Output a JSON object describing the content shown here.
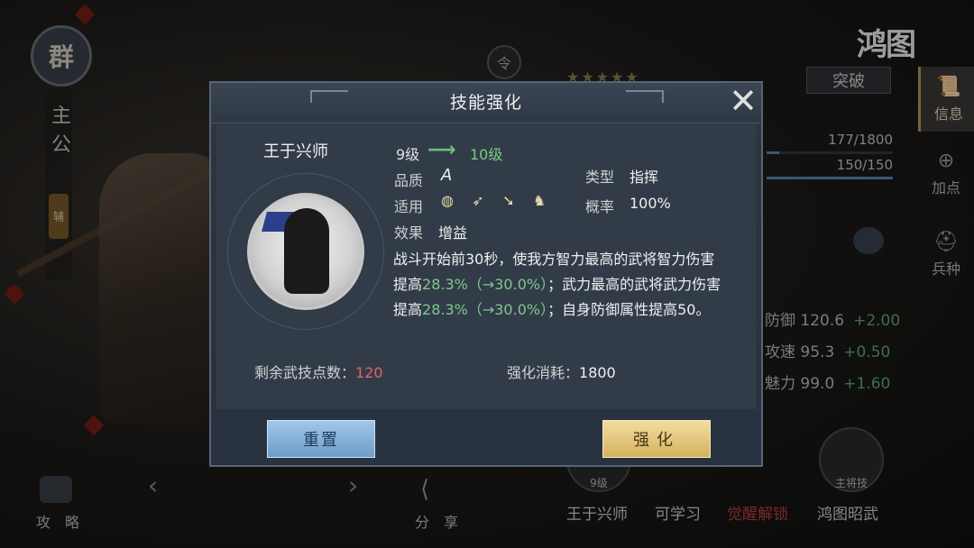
{
  "game": {
    "faction": "群",
    "lord_label": "主公",
    "side_tag": "辅",
    "token": "令",
    "logo": "鸿图",
    "breakthrough_label": "突破",
    "stars": "★★★★★",
    "side_tabs": [
      {
        "label": "信息",
        "icon": "scroll-icon",
        "active": true
      },
      {
        "label": "加点",
        "icon": "add-point-icon",
        "active": false
      },
      {
        "label": "兵种",
        "icon": "helmet-icon",
        "active": false
      }
    ],
    "exp_text": "177/1800",
    "exp_fraction": 0.098,
    "hp_text": "150/150",
    "hp_fraction": 1.0,
    "stats": [
      {
        "name": "防御",
        "value": "120.6",
        "bonus": "+2.00"
      },
      {
        "name": "攻速",
        "value": "95.3",
        "bonus": "+0.50"
      },
      {
        "name": "魅力",
        "value": "99.0",
        "bonus": "+1.60"
      }
    ],
    "bottom_skills": [
      {
        "name": "王于兴师",
        "badge": "9级"
      },
      {
        "name": "可学习",
        "badge": ""
      },
      {
        "name": "觉醒解锁",
        "badge": ""
      },
      {
        "name": "鸿图昭武",
        "badge": "主将技"
      }
    ],
    "guide_label": "攻　略",
    "share_label": "分　享"
  },
  "modal": {
    "title": "技能强化",
    "skill_name": "王于兴师",
    "level_from": "9级",
    "level_to": "10级",
    "quality_label": "品质",
    "quality_value": "A",
    "type_label": "类型",
    "type_value": "指挥",
    "apply_label": "适用",
    "apply_icons": [
      "shield-icon",
      "bow-icon",
      "spear-icon",
      "horse-icon"
    ],
    "rate_label": "概率",
    "rate_value": "100%",
    "effect_label": "效果",
    "effect_value": "增益",
    "desc_1": "战斗开始前30秒，使我方智力最高的武将智力伤害提高",
    "desc_g1": "28.3%（→30.0%）",
    "desc_2": "；武力最高的武将武力伤害提高",
    "desc_g2": "28.3%（→30.0%）",
    "desc_3": "；自身防御属性提高50。",
    "points_label": "剩余武技点数：",
    "points_value": "120",
    "cost_label": "强化消耗：",
    "cost_value": "1800",
    "reset_label": "重置",
    "enhance_label": "强化"
  },
  "colors": {
    "highlight_green": "#7ec98a",
    "points_red": "#e0646a",
    "gold_button": "#d5b25e",
    "blue_button": "#6e9cc9"
  }
}
